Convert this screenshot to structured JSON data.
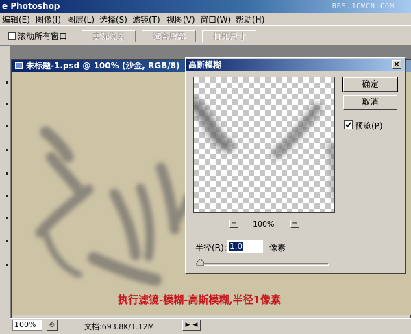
{
  "app": {
    "title": "e Photoshop",
    "watermark": "BBS.JCWCN.COM"
  },
  "menu": [
    {
      "label": "编辑(E)"
    },
    {
      "label": "图像(I)"
    },
    {
      "label": "图层(L)"
    },
    {
      "label": "选择(S)"
    },
    {
      "label": "滤镜(T)"
    },
    {
      "label": "视图(V)"
    },
    {
      "label": "窗口(W)"
    },
    {
      "label": "帮助(H)"
    }
  ],
  "options_bar": {
    "scroll_all_windows": "滚动所有窗口",
    "scroll_all_checked": false,
    "actual_pixels": "实际像素",
    "fit_screen": "适合屏幕",
    "print_size": "打印尺寸"
  },
  "document": {
    "title": "未标题-1.psd @ 100% (沙金, RGB/8)",
    "canvas_color": "#cdc3a5",
    "caption": "执行滤镜-模糊-高斯模糊,半径1像素",
    "caption_color": "#c8161d"
  },
  "dialog": {
    "title": "高斯模糊",
    "close_glyph": "×",
    "ok_label": "确定",
    "cancel_label": "取消",
    "preview_label": "预览(P)",
    "preview_checked": true,
    "zoom_out": "−",
    "zoom_in": "+",
    "zoom_level": "100%",
    "radius_label": "半径(R):",
    "radius_value": "1.0",
    "radius_unit": "像素",
    "radius_slider_fraction": 0.03
  },
  "status": {
    "zoom": "100%",
    "doc_info": "文档:693.8K/1.12M"
  },
  "colors": {
    "titlebar": "#0a246a",
    "chrome": "#d4d0c8",
    "checker": "#c6c6c6"
  }
}
